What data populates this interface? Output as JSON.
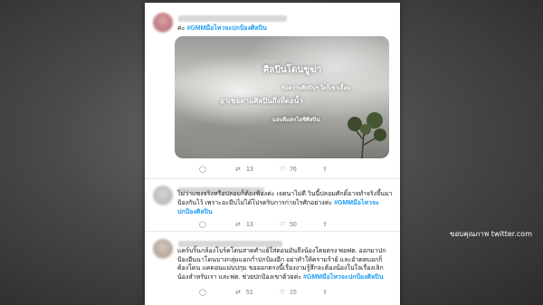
{
  "tweets": [
    {
      "text": "",
      "hashtag": "#GMMมือไหวจะปกป้องศิลปิน",
      "prefix": "ค่ะ",
      "image_overlay": {
        "line1": "ศิลปินโดนขู่ฆ่า",
        "line2": "ข้อความศิลปินฯ ใดก็เขาเอื้อม",
        "line3": "อาเชอดามศิลปินถึงที่ดอน้ำ",
        "line4": "แอบตีแสกไอซีศิลปิน"
      },
      "retweets": "13",
      "likes": "76"
    },
    {
      "text": "ไม่ว่าแซงจริงหรือปลอมก็ต้องฟ้องค่ะ เจตนาไม่ดี วินนี้ปลอมศักดิ์อาจทำจริงจึ้นมา ป้องกันไว้ เพราะอะมีบไม่ได้โปรดริบการก่ายไรศักอย่างค่ะ",
      "hashtag": "#GMMมือไหวจะปกป้องศิลปิน",
      "retweets": "13",
      "likes": "50"
    },
    {
      "text": "แคร์บริ้นกล้องโบร์คโดนสาดศำแย้ใส่ตอนมันถึงน้องโดยตรง พอฟต. ออกมาปกป้องอีนนาโดนบางกลุ่มแอกก่ำปกป้องอีก อย่าทำให้ครามร้าย์ และอำดตบอกก็ต้องโดน แคดอนแม่บปกุม ขอออกตรงนี้เรื่องงามรู้สึกจะต้องน้องในใจเรื่องเลิกน้องลำหรับเรา และฟต. ช่วยปกป้องเขาด้วยค่ะ",
      "hashtag": "#GMMมือไหวจะปกป้องศิลปิน",
      "retweets": "51",
      "likes": "15"
    }
  ],
  "credit": "ขอบคุณภาพ twitter.com",
  "colors": {
    "link": "#1d9bf0",
    "text": "#14171a",
    "meta": "#657786"
  },
  "icons": [
    "reply-icon",
    "retweet-icon",
    "like-icon",
    "share-icon"
  ]
}
